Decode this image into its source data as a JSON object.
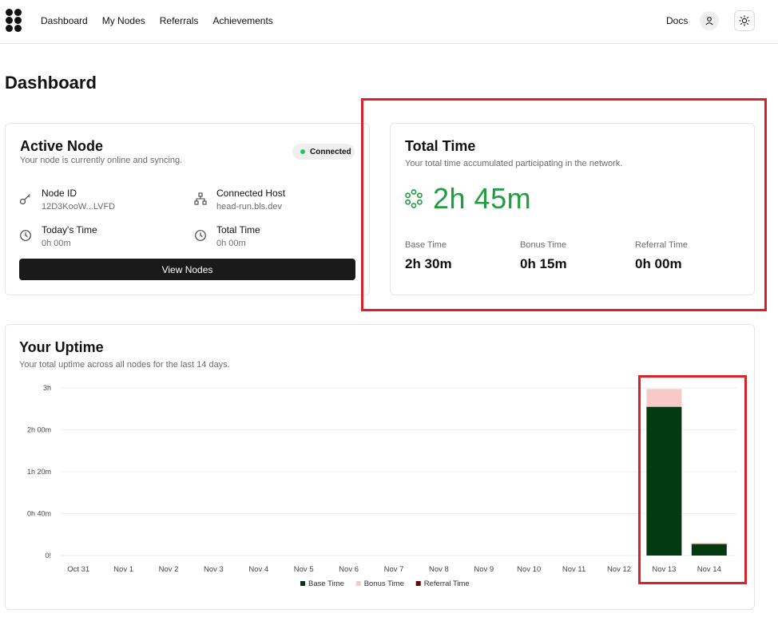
{
  "nav": {
    "items": [
      "Dashboard",
      "My Nodes",
      "Referrals",
      "Achievements"
    ],
    "docs": "Docs"
  },
  "page_title": "Dashboard",
  "active_node": {
    "title": "Active Node",
    "subtitle": "Your node is currently online and syncing.",
    "status": "Connected",
    "node_id_label": "Node ID",
    "node_id_value": "12D3KooW...LVFD",
    "host_label": "Connected Host",
    "host_value": "head-run.bls.dev",
    "today_label": "Today's Time",
    "today_value": "0h 00m",
    "total_label": "Total Time",
    "total_value": "0h 00m",
    "button": "View Nodes"
  },
  "total_time": {
    "title": "Total Time",
    "subtitle": "Your total time accumulated participating in the network.",
    "value": "2h 45m",
    "base_label": "Base Time",
    "base_value": "2h 30m",
    "bonus_label": "Bonus Time",
    "bonus_value": "0h 15m",
    "referral_label": "Referral Time",
    "referral_value": "0h 00m"
  },
  "uptime": {
    "title": "Your Uptime",
    "subtitle": "Your total uptime across all nodes for the last 14 days."
  },
  "colors": {
    "accent_green": "#1f9d3f",
    "base": "#033a12",
    "bonus": "#f8c9c9",
    "referral": "#5c0b0b",
    "highlight": "#d9232b"
  },
  "chart_data": {
    "type": "bar",
    "stacked": true,
    "categories": [
      "Oct 31",
      "Nov 1",
      "Nov 2",
      "Nov 3",
      "Nov 4",
      "Nov 5",
      "Nov 6",
      "Nov 7",
      "Nov 8",
      "Nov 9",
      "Nov 10",
      "Nov 11",
      "Nov 12",
      "Nov 13",
      "Nov 14"
    ],
    "series": [
      {
        "name": "Base Time",
        "color": "#033a12",
        "values": [
          0,
          0,
          0,
          0,
          0,
          0,
          0,
          0,
          0,
          0,
          0,
          0,
          0,
          142,
          11
        ]
      },
      {
        "name": "Bonus Time",
        "color": "#f8c9c9",
        "values": [
          0,
          0,
          0,
          0,
          0,
          0,
          0,
          0,
          0,
          0,
          0,
          0,
          0,
          17,
          1
        ]
      },
      {
        "name": "Referral Time",
        "color": "#5c0b0b",
        "values": [
          0,
          0,
          0,
          0,
          0,
          0,
          0,
          0,
          0,
          0,
          0,
          0,
          0,
          0,
          0
        ]
      }
    ],
    "y_ticks": [
      {
        "value": 0,
        "label": "0!"
      },
      {
        "value": 40,
        "label": "0h 40m"
      },
      {
        "value": 80,
        "label": "1h 20m"
      },
      {
        "value": 120,
        "label": "2h 00m"
      },
      {
        "value": 160,
        "label": "3h"
      }
    ],
    "ylim": [
      0,
      160
    ],
    "value_unit": "minutes",
    "grid": true,
    "legend": "bottom-center"
  }
}
